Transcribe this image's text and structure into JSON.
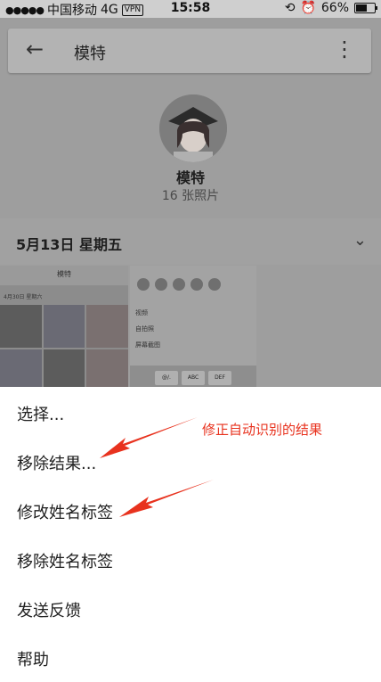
{
  "status_bar": {
    "carrier": "中国移动",
    "network": "4G",
    "vpn": "VPN",
    "time": "15:58",
    "battery_percent": "66%",
    "battery_level": 0.66
  },
  "toolbar": {
    "back_icon": "arrow-left-icon",
    "title": "模特",
    "more_icon": "more-vert-icon"
  },
  "profile": {
    "name": "模特",
    "photo_count": "16 张照片"
  },
  "section": {
    "date": "5月13日 星期五",
    "expand_icon": "chevron-down-icon"
  },
  "thumbnails": {
    "thumb1_title": "模特",
    "thumb1_sub": "4月30日 星期六",
    "thumb2_rows": [
      "视频",
      "自拍照",
      "屏幕截图"
    ],
    "thumb2_keys": [
      "@/.",
      "ABC",
      "DEF"
    ]
  },
  "menu": {
    "items": [
      "选择...",
      "移除结果...",
      "修改姓名标签",
      "移除姓名标签",
      "发送反馈",
      "帮助"
    ]
  },
  "annotation": {
    "text": "修正自动识别的结果",
    "color": "#e8321e"
  },
  "colors": {
    "overlay": "#9e9e9e",
    "sheet": "#ffffff",
    "annotation_red": "#e8321e"
  }
}
